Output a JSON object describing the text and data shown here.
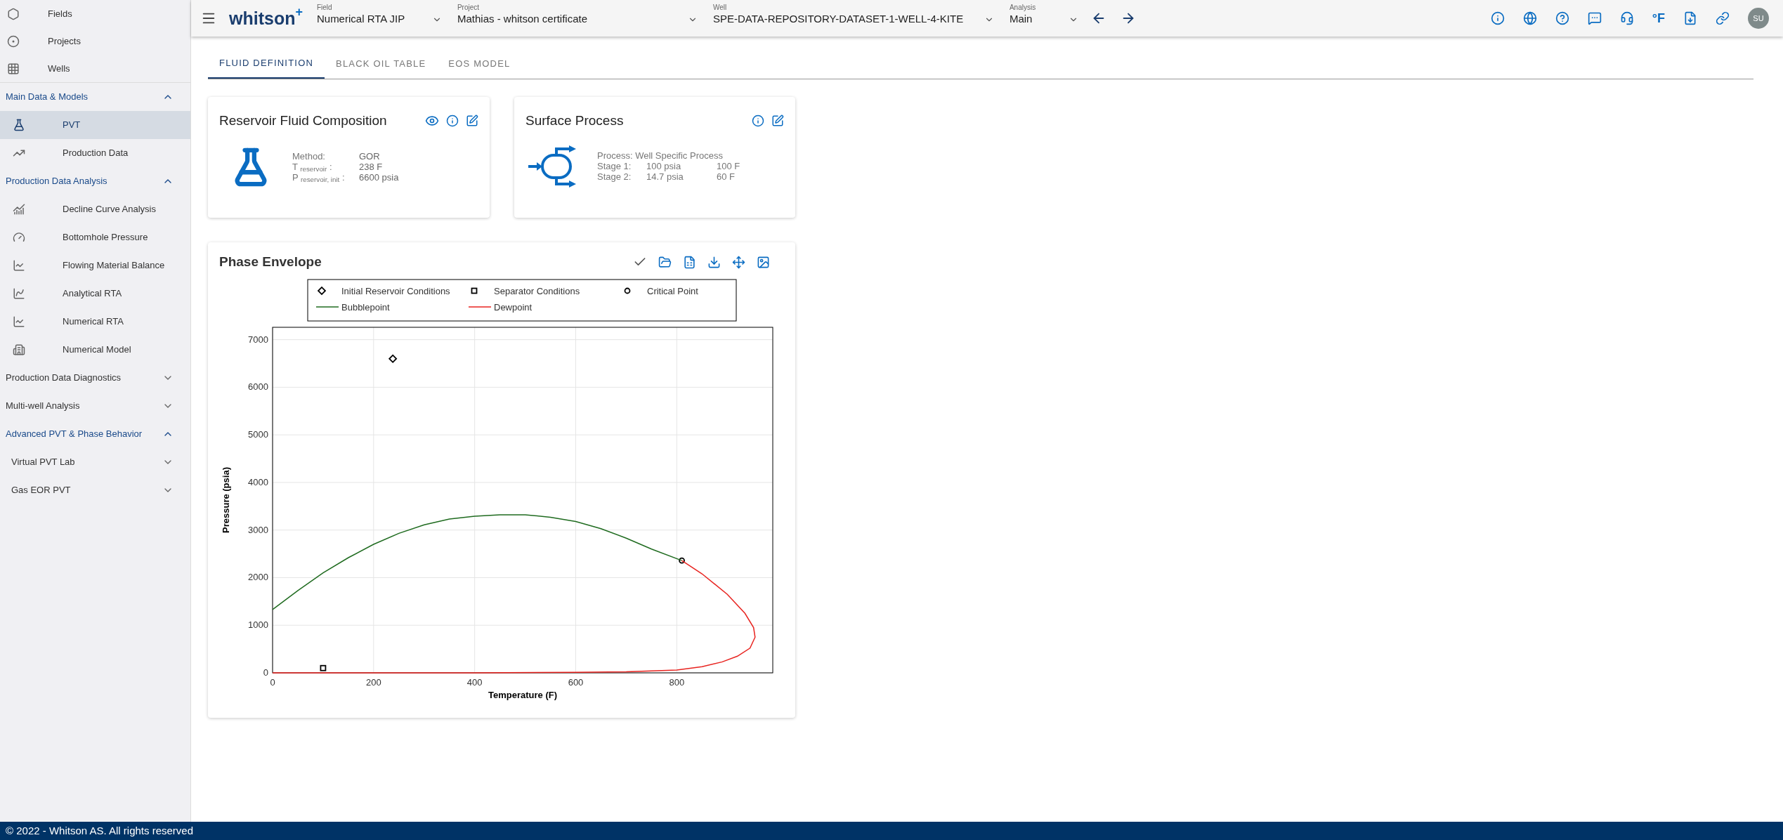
{
  "sidebar": {
    "nav_items": [
      {
        "label": "Fields"
      },
      {
        "label": "Projects"
      },
      {
        "label": "Wells"
      }
    ],
    "sections": [
      {
        "title": "Main Data & Models",
        "expanded": true,
        "items": [
          {
            "kind": "link",
            "label": "PVT",
            "selected": true
          },
          {
            "kind": "link",
            "label": "Production Data",
            "selected": false
          }
        ]
      },
      {
        "title": "Production Data Analysis",
        "expanded": true,
        "items": [
          {
            "kind": "link",
            "label": "Decline Curve Analysis",
            "selected": false
          },
          {
            "kind": "link",
            "label": "Bottomhole Pressure",
            "selected": false
          },
          {
            "kind": "link",
            "label": "Flowing Material Balance",
            "selected": false
          },
          {
            "kind": "link",
            "label": "Analytical RTA",
            "selected": false
          },
          {
            "kind": "link",
            "label": "Numerical RTA",
            "selected": false
          },
          {
            "kind": "link",
            "label": "Numerical Model",
            "selected": false
          }
        ]
      },
      {
        "title": "Production Data Diagnostics",
        "expanded": false
      },
      {
        "title": "Multi-well Analysis",
        "expanded": false
      },
      {
        "title": "Advanced PVT & Phase Behavior",
        "expanded": true,
        "items": [
          {
            "kind": "group",
            "label": "Virtual PVT Lab",
            "expanded": false
          },
          {
            "kind": "group",
            "label": "Gas EOR PVT",
            "expanded": false
          }
        ]
      }
    ]
  },
  "top_bar": {
    "logo": "whitson",
    "logo_mark": "+",
    "selectors": [
      {
        "label": "Field",
        "value": "Numerical RTA JIP"
      },
      {
        "label": "Project",
        "value": "Mathias - whitson certificate"
      },
      {
        "label": "Well",
        "value": "SPE-DATA-REPOSITORY-DATASET-1-WELL-4-KITE"
      },
      {
        "label": "Analysis",
        "value": "Main"
      }
    ],
    "unit_button": "°F",
    "avatar": "SU"
  },
  "tabs": [
    {
      "label": "FLUID DEFINITION",
      "selected": true
    },
    {
      "label": "BLACK OIL TABLE",
      "selected": false
    },
    {
      "label": "EOS MODEL",
      "selected": false
    }
  ],
  "reservoir_card": {
    "title": "Reservoir Fluid Composition",
    "rows": [
      {
        "label": "Method:",
        "value": "GOR"
      },
      {
        "label": "T $_{reservoir}$ :",
        "value": "238 F"
      },
      {
        "label": "P $_{reservoir, init}$ :",
        "value": "6600 psia"
      }
    ]
  },
  "surface_card": {
    "title": "Surface Process",
    "process": "Process: Well Specific Process",
    "stages": [
      {
        "name": "Stage 1:",
        "pressure": "100 psia",
        "temperature": "100 F"
      },
      {
        "name": "Stage 2:",
        "pressure": "14.7 psia",
        "temperature": "60 F"
      }
    ]
  },
  "phase_envelope": {
    "title": "Phase Envelope",
    "chart_data": {
      "type": "line",
      "xlabel": "Temperature (F)",
      "ylabel": "Pressure (psia)",
      "xlim": [
        0,
        990
      ],
      "ylim": [
        0,
        7260
      ],
      "grid": true,
      "legend": true,
      "xticks": [
        0,
        200,
        400,
        600,
        800
      ],
      "yticks": [
        0,
        1000,
        2000,
        3000,
        4000,
        5000,
        6000,
        7000
      ],
      "series": [
        {
          "name": "Initial Reservoir Conditions",
          "marker": "diamond",
          "color": "#000000",
          "x": [
            238
          ],
          "values": [
            6600
          ]
        },
        {
          "name": "Separator Conditions",
          "marker": "square",
          "color": "#000000",
          "x": [
            100
          ],
          "values": [
            100
          ]
        },
        {
          "name": "Critical Point",
          "marker": "circle",
          "color": "#000000",
          "x": [
            810
          ],
          "values": [
            2360
          ]
        },
        {
          "name": "Bubblepoint",
          "color": "#1f6b1f",
          "x": [
            0,
            50,
            100,
            150,
            200,
            250,
            300,
            350,
            400,
            450,
            500,
            550,
            600,
            650,
            700,
            750,
            810
          ],
          "values": [
            1330,
            1730,
            2100,
            2420,
            2700,
            2930,
            3110,
            3230,
            3290,
            3320,
            3320,
            3270,
            3180,
            3030,
            2830,
            2600,
            2360
          ]
        },
        {
          "name": "Dewpoint",
          "color": "#e8231f",
          "x": [
            810,
            850,
            900,
            935,
            952,
            955,
            945,
            920,
            890,
            850,
            800,
            700,
            600,
            400,
            200,
            0
          ],
          "values": [
            2360,
            2080,
            1650,
            1250,
            950,
            750,
            520,
            350,
            230,
            130,
            60,
            20,
            10,
            0,
            0,
            0
          ]
        }
      ]
    }
  },
  "footer": "© 2022 - Whitson AS. All rights reserved"
}
